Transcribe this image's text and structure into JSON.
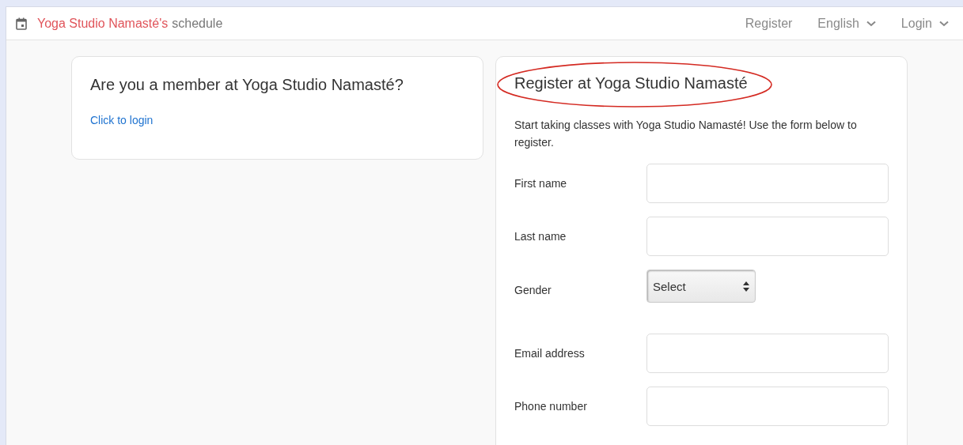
{
  "header": {
    "studio": "Yoga Studio Namasté's",
    "title": "schedule",
    "nav": [
      {
        "label": "Register",
        "kind": "link"
      },
      {
        "label": "English",
        "kind": "dropdown"
      },
      {
        "label": "Login",
        "kind": "dropdown"
      }
    ]
  },
  "member_card": {
    "heading": "Are you a member at Yoga Studio Namasté?",
    "link": "Click to login"
  },
  "register_card": {
    "heading": "Register at Yoga Studio Namasté",
    "highlighted": true,
    "intro": "Start taking classes with Yoga Studio Namasté! Use the form below to register.",
    "fields": [
      {
        "label": "First name",
        "kind": "text"
      },
      {
        "label": "Last name",
        "kind": "text"
      },
      {
        "label": "Gender",
        "kind": "select",
        "value": "Select"
      },
      {
        "label": "Email address",
        "kind": "text"
      },
      {
        "label": "Phone number",
        "kind": "text"
      }
    ]
  }
}
